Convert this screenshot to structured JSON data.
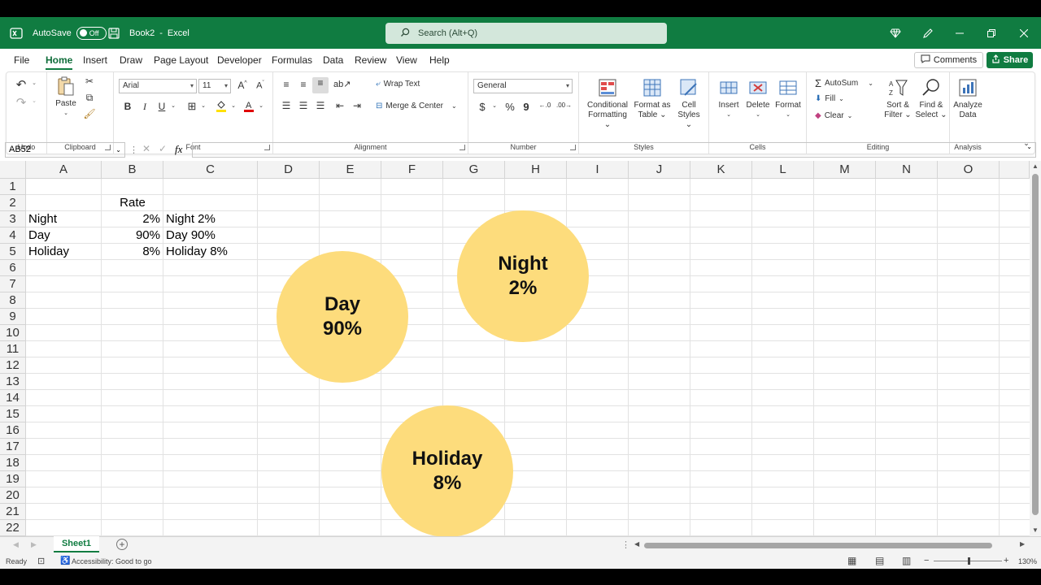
{
  "title_bar": {
    "autosave_label": "AutoSave",
    "autosave_state": "Off",
    "doc_name": "Book2",
    "separator": "-",
    "app_name": "Excel",
    "search_placeholder": "Search (Alt+Q)"
  },
  "menu": {
    "tabs": [
      "File",
      "Home",
      "Insert",
      "Draw",
      "Page Layout",
      "Developer",
      "Formulas",
      "Data",
      "Review",
      "View",
      "Help"
    ],
    "active_tab": "Home",
    "comments_label": "Comments",
    "share_label": "Share"
  },
  "ribbon": {
    "undo": {
      "group": "Undo"
    },
    "clipboard": {
      "group": "Clipboard",
      "paste": "Paste"
    },
    "font": {
      "group": "Font",
      "font_name": "Arial",
      "font_size": "11",
      "bold": "B",
      "italic": "I",
      "underline": "U"
    },
    "alignment": {
      "group": "Alignment",
      "wrap_text": "Wrap Text",
      "merge_center": "Merge & Center"
    },
    "number": {
      "group": "Number",
      "format": "General",
      "currency": "$",
      "percent": "%",
      "comma": "9"
    },
    "styles": {
      "group": "Styles",
      "conditional_1": "Conditional",
      "conditional_2": "Formatting",
      "format_table_1": "Format as",
      "format_table_2": "Table",
      "cell_styles_1": "Cell",
      "cell_styles_2": "Styles"
    },
    "cells": {
      "group": "Cells",
      "insert": "Insert",
      "delete": "Delete",
      "format": "Format"
    },
    "editing": {
      "group": "Editing",
      "autosum": "AutoSum",
      "fill": "Fill",
      "clear": "Clear",
      "sort_1": "Sort &",
      "sort_2": "Filter",
      "find_1": "Find &",
      "find_2": "Select"
    },
    "analysis": {
      "group": "Analysis",
      "analyze_1": "Analyze",
      "analyze_2": "Data"
    }
  },
  "formula_bar": {
    "name_box": "AB52",
    "fx": "fx",
    "formula": ""
  },
  "columns": [
    "A",
    "B",
    "C",
    "D",
    "E",
    "F",
    "G",
    "H",
    "I",
    "J",
    "K",
    "L",
    "M",
    "N",
    "O"
  ],
  "rows": [
    "1",
    "2",
    "3",
    "4",
    "5",
    "6",
    "7",
    "8",
    "9",
    "10",
    "11",
    "12",
    "13",
    "14",
    "15",
    "16",
    "17",
    "18",
    "19",
    "20",
    "21",
    "22"
  ],
  "cells": {
    "B1": "Rate",
    "A2": "Night",
    "B2": "2%",
    "C2": "Night 2%",
    "A3": "Day",
    "B3": "90%",
    "C3": "Day 90%",
    "A4": "Holiday",
    "B4": "8%",
    "C4": "Holiday 8%"
  },
  "bubbles": [
    {
      "label": "Day",
      "value": "90%"
    },
    {
      "label": "Night",
      "value": "2%"
    },
    {
      "label": "Holiday",
      "value": "8%"
    }
  ],
  "bubble_color": "#fddc7c",
  "accent_color": "#107c41",
  "sheet_tabs": {
    "active": "Sheet1"
  },
  "status_bar": {
    "ready": "Ready",
    "accessibility": "Accessibility: Good to go",
    "zoom": "130%"
  }
}
